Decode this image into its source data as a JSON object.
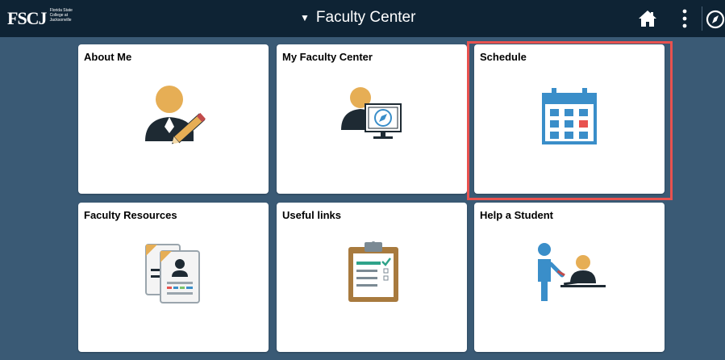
{
  "header": {
    "logo_text": "FSCJ",
    "logo_subtext": "Florida State College at Jacksonville",
    "title": "Faculty Center",
    "caret": "▼"
  },
  "tiles": [
    {
      "label": "About Me",
      "icon": "user-edit-icon"
    },
    {
      "label": "My Faculty Center",
      "icon": "user-monitor-icon"
    },
    {
      "label": "Schedule",
      "icon": "calendar-icon"
    },
    {
      "label": "Faculty Resources",
      "icon": "documents-icon"
    },
    {
      "label": "Useful links",
      "icon": "clipboard-icon"
    },
    {
      "label": "Help a Student",
      "icon": "advising-icon"
    }
  ],
  "colors": {
    "header_bg": "#0e2334",
    "page_bg": "#3a5a75",
    "highlight": "#e8524f",
    "accent_blue": "#3a8ec9",
    "accent_gold": "#e6ae55"
  }
}
